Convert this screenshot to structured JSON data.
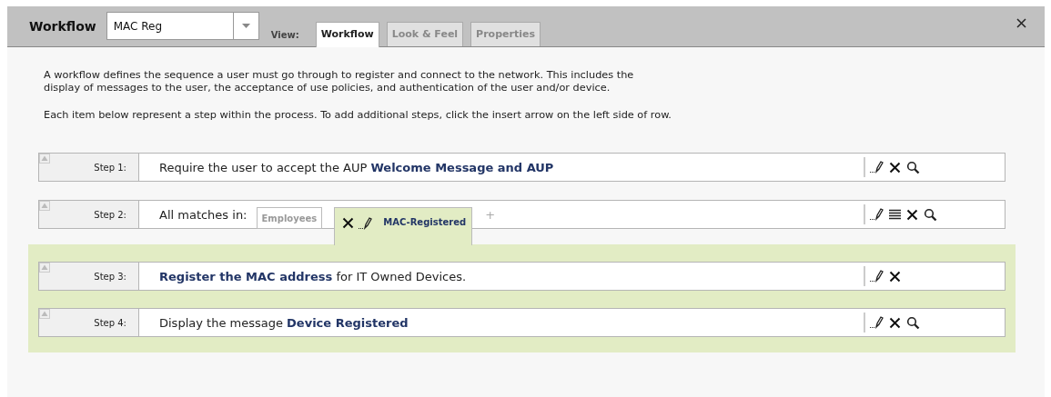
{
  "header": {
    "title": "Workflow",
    "workflow_select": {
      "value": "MAC Reg"
    },
    "view_label": "View:",
    "tabs": [
      {
        "label": "Workflow",
        "selected": true
      },
      {
        "label": "Look & Feel",
        "selected": false
      },
      {
        "label": "Properties",
        "selected": false
      }
    ]
  },
  "description": [
    "A workflow defines the sequence a user must go through to register and connect to the network. This includes the display of messages to the user, the acceptance of use policies, and authentication of the user and/or device.",
    "Each item below represent a step within the process. To add additional steps, click the insert arrow on the left side of row."
  ],
  "steps": [
    {
      "label": "Step 1:",
      "text": "Require the user to accept the AUP **Welcome Message and AUP**",
      "actions": [
        {
          "kind": "edit"
        },
        {
          "kind": "delete"
        },
        {
          "kind": "view"
        }
      ]
    },
    {
      "label": "Step 2:",
      "text": "All matches in:",
      "actions": [
        {
          "kind": "edit"
        },
        {
          "kind": "reorder"
        },
        {
          "kind": "delete"
        },
        {
          "kind": "view"
        }
      ],
      "add_label": "+",
      "groups": [
        {
          "label": "Employees",
          "selected": false
        },
        {
          "label": "MAC-Registered",
          "selected": true,
          "actions": [
            {
              "kind": "delete"
            },
            {
              "kind": "edit"
            }
          ]
        }
      ],
      "group_steps": [
        {
          "label": "Step 3:",
          "text": "**Register the MAC address** for IT Owned Devices.",
          "actions": [
            {
              "kind": "edit"
            },
            {
              "kind": "delete"
            }
          ]
        },
        {
          "label": "Step 4:",
          "text": "Display the message **Device Registered**",
          "actions": [
            {
              "kind": "edit"
            },
            {
              "kind": "delete"
            },
            {
              "kind": "view"
            }
          ]
        }
      ]
    }
  ]
}
